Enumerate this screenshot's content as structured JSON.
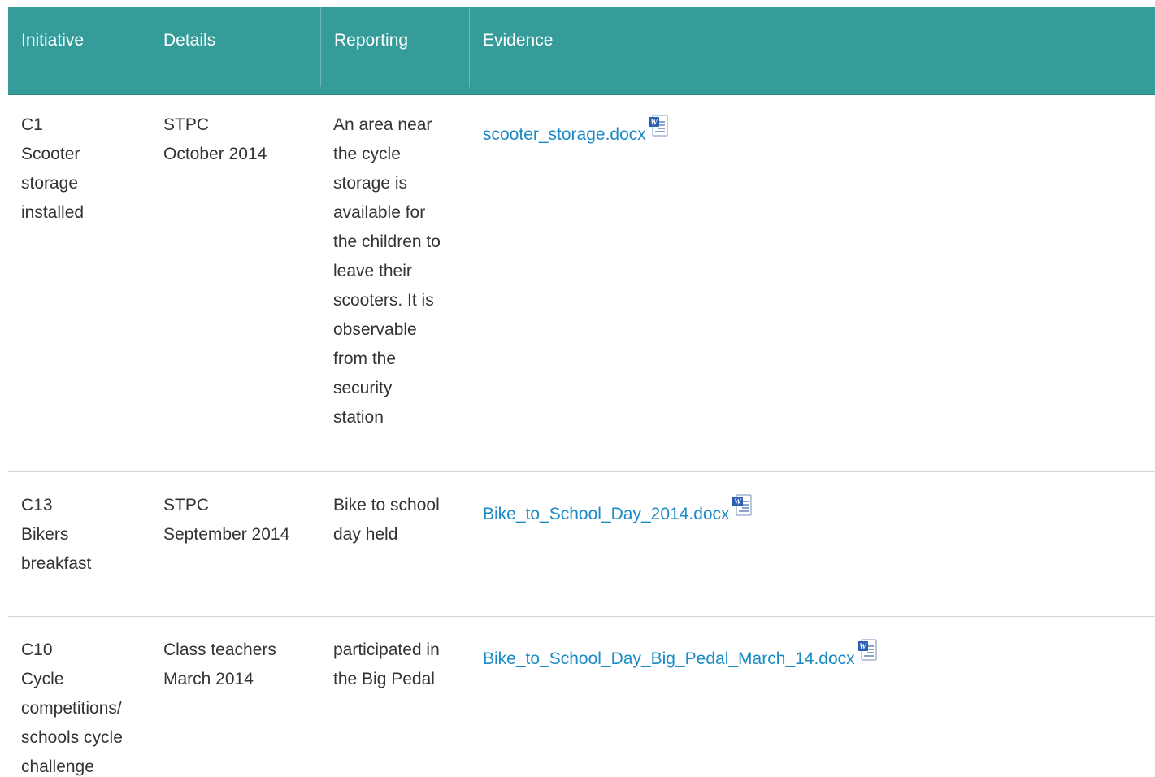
{
  "table": {
    "headers": {
      "initiative": "Initiative",
      "details": "Details",
      "reporting": "Reporting",
      "evidence": "Evidence"
    },
    "rows": [
      {
        "initiative_lines": [
          "C1",
          "Scooter",
          "storage",
          "installed"
        ],
        "details_lines": [
          "STPC",
          "October 2014"
        ],
        "reporting_lines": [
          "An area near",
          "the cycle",
          "storage is",
          "available for",
          "the children to",
          "leave their",
          "scooters. It is",
          "observable",
          "from the",
          "security",
          "station"
        ],
        "evidence_link": "scooter_storage.docx",
        "evidence_icon": "word-document-icon"
      },
      {
        "initiative_lines": [
          "C13",
          "Bikers",
          "breakfast"
        ],
        "details_lines": [
          "STPC",
          "September 2014"
        ],
        "reporting_lines": [
          "Bike to school",
          "day held"
        ],
        "evidence_link": "Bike_to_School_Day_2014.docx",
        "evidence_icon": "word-document-icon"
      },
      {
        "initiative_lines": [
          "C10",
          "Cycle",
          "competitions/",
          "schools cycle",
          "challenge"
        ],
        "details_lines": [
          "Class teachers",
          "March 2014"
        ],
        "reporting_lines": [
          "participated in",
          "the Big Pedal"
        ],
        "evidence_link": "Bike_to_School_Day_Big_Pedal_March_14.docx",
        "evidence_icon": "word-document-icon"
      }
    ]
  },
  "colors": {
    "header_bg": "#359c9a",
    "header_text": "#ffffff",
    "link": "#1a8bc6",
    "body_text": "#333333",
    "row_border": "#d6d6d6"
  }
}
